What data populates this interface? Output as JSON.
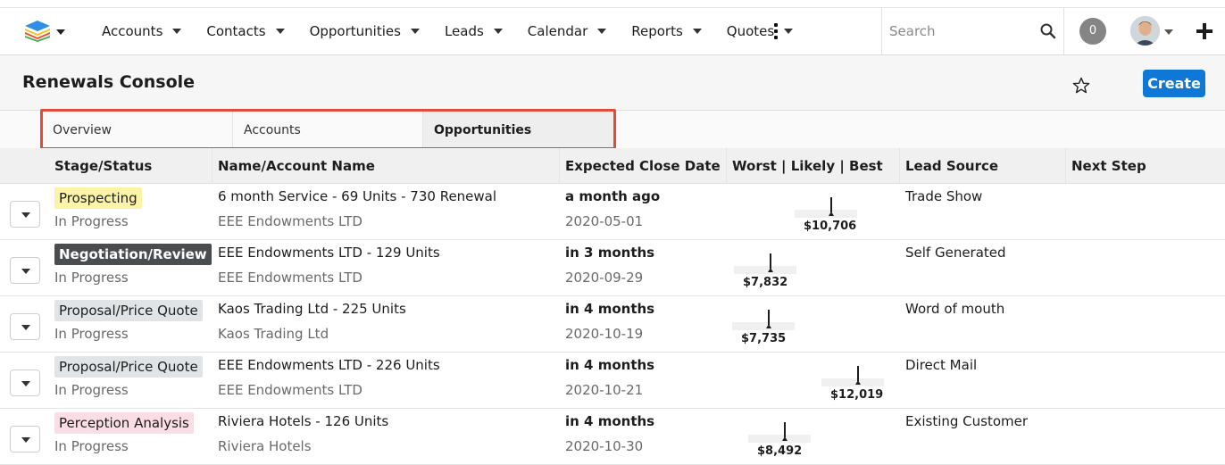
{
  "topbar": {
    "logo_icon": "stacked-cubes-logo-icon",
    "nav": [
      {
        "label": "Accounts"
      },
      {
        "label": "Contacts"
      },
      {
        "label": "Opportunities"
      },
      {
        "label": "Leads"
      },
      {
        "label": "Calendar"
      },
      {
        "label": "Reports"
      },
      {
        "label": "Quotes"
      }
    ],
    "more_icon": "vertical-ellipsis-icon",
    "search_placeholder": "Search",
    "notification_count": "0",
    "plus_icon": "plus-icon"
  },
  "header": {
    "title": "Renewals Console",
    "favorite_icon": "star-outline-icon",
    "create_label": "Create"
  },
  "tabs": [
    {
      "label": "Overview",
      "active": false
    },
    {
      "label": "Accounts",
      "active": false
    },
    {
      "label": "Opportunities",
      "active": true
    }
  ],
  "columns": [
    "Stage/Status",
    "Name/Account Name",
    "Expected Close Date",
    "Worst | Likely | Best",
    "Lead Source",
    "Next Step"
  ],
  "rows": [
    {
      "stage": "Prospecting",
      "status": "In Progress",
      "name": "6 month Service - 69 Units - 730 Renewal",
      "account": "EEE Endowments LTD",
      "close_relative": "a month ago",
      "close_date": "2020-05-01",
      "likely": "$10,706",
      "likely_value": 10706,
      "lead_source": "Trade Show",
      "next_step": "",
      "badge_color": "#fbf3a5"
    },
    {
      "stage": "Negotiation/Review",
      "status": "In Progress",
      "name": "EEE Endowments LTD - 129 Units",
      "account": "EEE Endowments LTD",
      "close_relative": "in 3 months",
      "close_date": "2020-09-29",
      "likely": "$7,832",
      "likely_value": 7832,
      "lead_source": "Self Generated",
      "next_step": "",
      "badge_color": "#4a4d50"
    },
    {
      "stage": "Proposal/Price Quote",
      "status": "In Progress",
      "name": "Kaos Trading Ltd - 225 Units",
      "account": "Kaos Trading Ltd",
      "close_relative": "in 4 months",
      "close_date": "2020-10-19",
      "likely": "$7,735",
      "likely_value": 7735,
      "lead_source": "Word of mouth",
      "next_step": "",
      "badge_color": "#e1e4e6"
    },
    {
      "stage": "Proposal/Price Quote",
      "status": "In Progress",
      "name": "EEE Endowments LTD - 226 Units",
      "account": "EEE Endowments LTD",
      "close_relative": "in 4 months",
      "close_date": "2020-10-21",
      "likely": "$12,019",
      "likely_value": 12019,
      "lead_source": "Direct Mail",
      "next_step": "",
      "badge_color": "#e1e4e6"
    },
    {
      "stage": "Perception Analysis",
      "status": "In Progress",
      "name": "Riviera Hotels - 126 Units",
      "account": "Riviera Hotels",
      "close_relative": "in 4 months",
      "close_date": "2020-10-30",
      "likely": "$8,492",
      "likely_value": 8492,
      "lead_source": "Existing Customer",
      "next_step": "",
      "badge_color": "#fbdde5"
    }
  ],
  "colors": {
    "accent": "#0f77d6",
    "highlight_box": "#e04b3a"
  }
}
